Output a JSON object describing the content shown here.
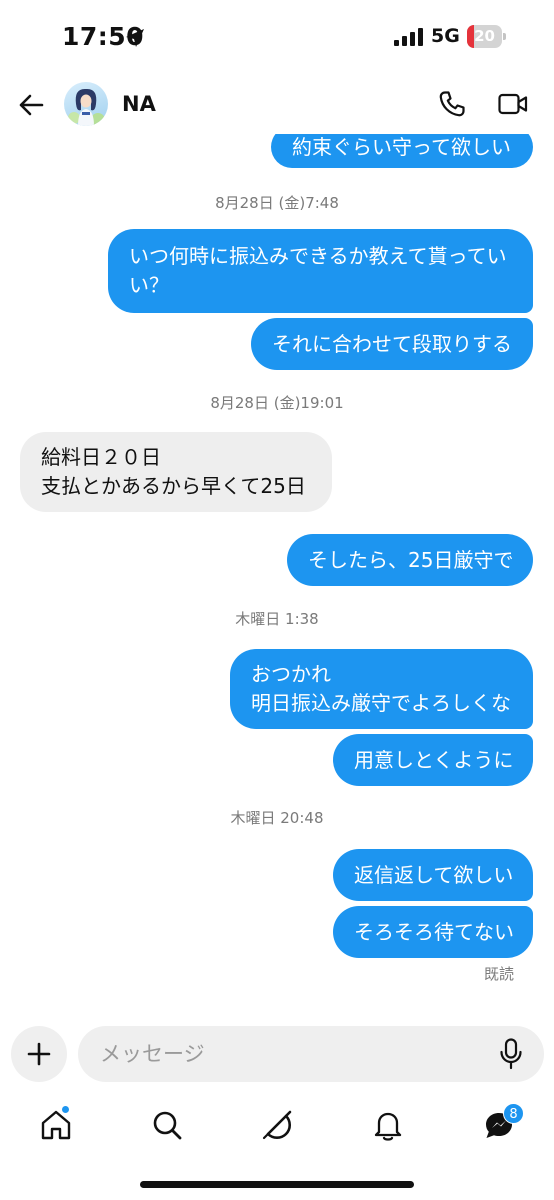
{
  "status": {
    "time": "17:50",
    "network": "5G",
    "battery": "20",
    "battery_level": 0.2
  },
  "header": {
    "name": "NA"
  },
  "messages": {
    "m1": "約束ぐらい守って欲しい",
    "ts1": "8月28日 (金)7:48",
    "m2_l1": "いつ何時に振込みできるか教えて貰ってい",
    "m2_l2": "い？",
    "m3": "それに合わせて段取りする",
    "ts2": "8月28日 (金)19:01",
    "m4_l1": "給料日２０日",
    "m4_l2": "支払とかあるから早くて25日",
    "m5": "そしたら、25日厳守で",
    "ts3": "木曜日 1:38",
    "m6_l1": "おつかれ",
    "m6_l2": "明日振込み厳守でよろしくな",
    "m7": "用意しとくように",
    "ts4": "木曜日 20:48",
    "m8": "返信返して欲しい",
    "m9": "そろそろ待てない",
    "seen": "既読"
  },
  "composer": {
    "placeholder": "メッセージ"
  },
  "tabs": {
    "messages_badge": "8"
  },
  "colors": {
    "accent": "#1d95f0",
    "incoming": "#eeeeee",
    "battery_low": "#e5333b"
  }
}
